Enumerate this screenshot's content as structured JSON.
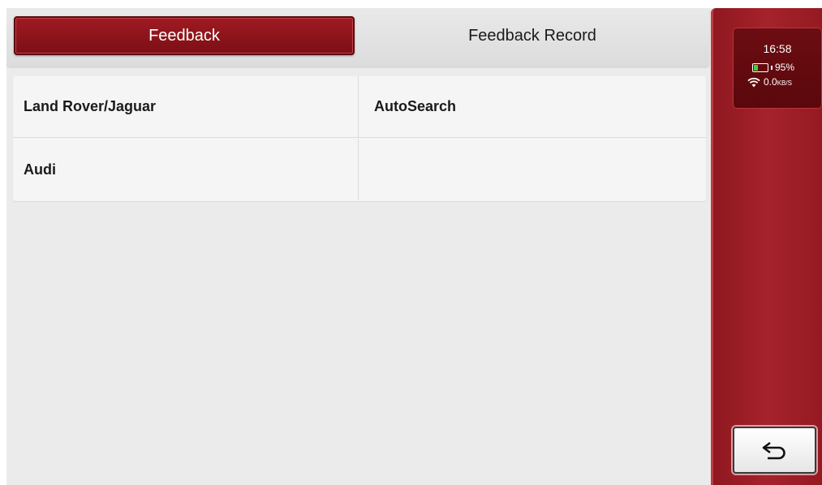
{
  "tabs": {
    "feedback": "Feedback",
    "feedback_record": "Feedback Record"
  },
  "items": [
    "Land Rover/Jaguar",
    "AutoSearch",
    "Audi"
  ],
  "status": {
    "time": "16:58",
    "battery": "95%",
    "battery_level": 0.95,
    "network_speed": "0.0",
    "network_unit": "KB/S"
  },
  "icons": {
    "battery": "battery-icon",
    "wifi": "wifi-icon",
    "back": "back-arrow-icon"
  },
  "colors": {
    "accent": "#8f1820",
    "active_tab": "#a01a22",
    "battery_fill": "#3ad43a"
  }
}
